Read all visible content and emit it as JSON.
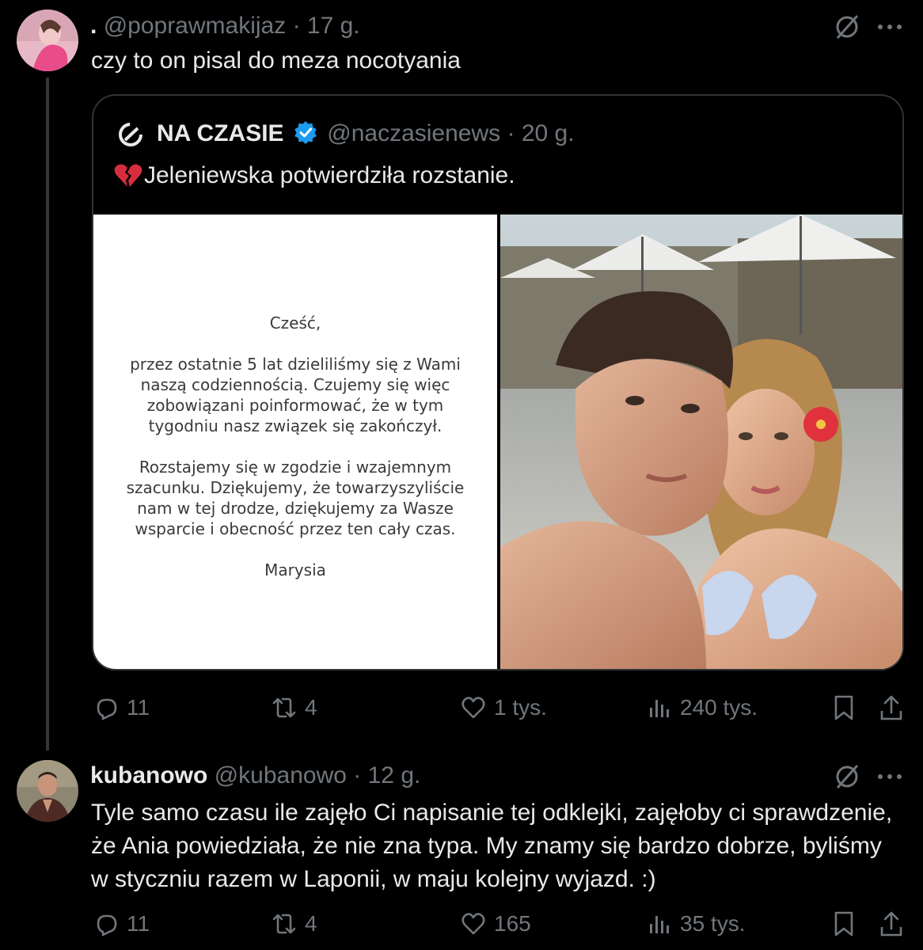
{
  "tweet1": {
    "dot": ".",
    "handle": "@poprawmakijaz",
    "sep": "·",
    "time": "17 g.",
    "text": "czy to on pisal do meza nocotyania",
    "actions": {
      "replies": "11",
      "reposts": "4",
      "likes": "1 tys.",
      "views": "240 tys."
    }
  },
  "quoted": {
    "name": "NA CZASIE",
    "handle": "@naczasienews",
    "sep": "·",
    "time": "20 g.",
    "text": "Jeleniewska potwierdziła rozstanie.",
    "letter": {
      "greeting": "Cześć,",
      "p1": [
        "przez ostatnie 5 lat dzieliliśmy się z Wami",
        "naszą codziennością. Czujemy się więc",
        "zobowiązani poinformować, że w tym",
        "tygodniu nasz związek się zakończył."
      ],
      "p2": [
        "Rozstajemy się w zgodzie i wzajemnym",
        "szacunku. Dziękujemy, że towarzyszyliście",
        "nam w tej drodze, dziękujemy za Wasze",
        "wsparcie i obecność przez ten cały czas."
      ],
      "signature": "Marysia"
    }
  },
  "tweet2": {
    "name": "kubanowo",
    "handle": "@kubanowo",
    "sep": "·",
    "time": "12 g.",
    "lines": [
      "Tyle samo czasu ile zajęło Ci napisanie tej odklejki, zajęłoby ci sprawdzenie,",
      "że Ania powiedziała, że nie zna typa. My znamy się bardzo dobrze, byliśmy",
      "w styczniu razem w Laponii, w maju kolejny wyjazd. :)"
    ],
    "actions": {
      "replies": "11",
      "reposts": "4",
      "likes": "165",
      "views": "35 tys."
    }
  },
  "colors": {
    "background": "#000000",
    "text": "#e7e9ea",
    "muted": "#71767b",
    "verified": "#1d9bf0",
    "border": "#2f3336"
  }
}
